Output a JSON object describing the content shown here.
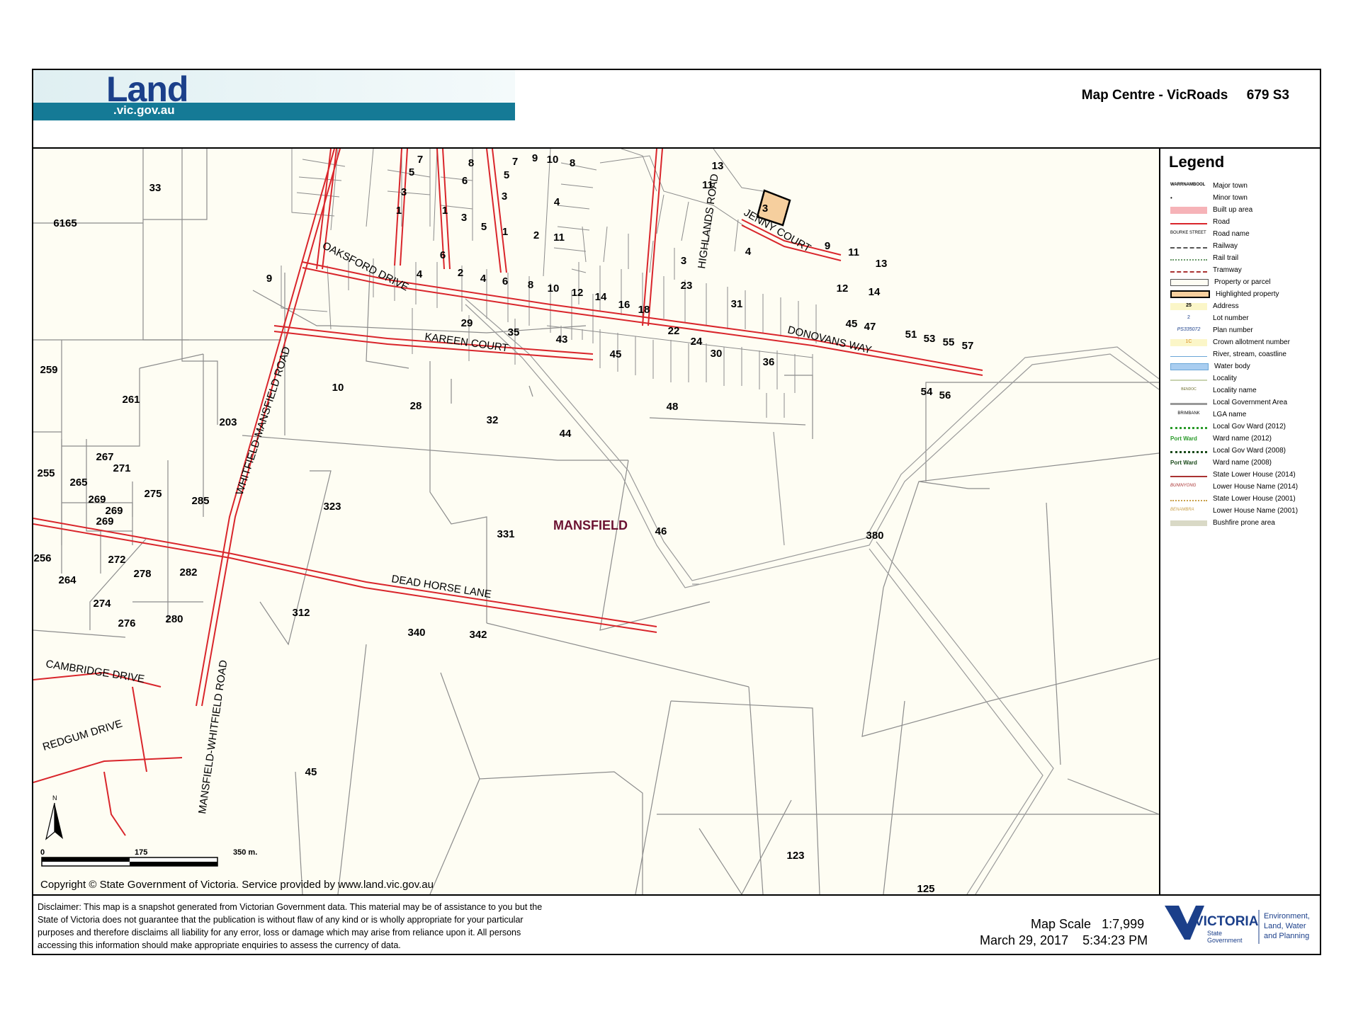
{
  "header": {
    "logo_main": "Land",
    "logo_sub": ".vic.gov.au",
    "title": "Map Centre - VicRoads",
    "map_ref": "679 S3"
  },
  "map": {
    "locality": "MANSFIELD",
    "roads": {
      "whitfield_mansfield": "WHITFIELD-MANSFIELD ROAD",
      "mansfield_whitfield": "MANSFIELD-WHITFIELD ROAD",
      "dead_horse": "DEAD HORSE LANE",
      "oaksford": "OAKSFORD DRIVE",
      "kareen": "KAREEN COURT",
      "highlands": "HIGHLANDS ROAD",
      "jenny": "JENNY COURT",
      "donovans": "DONOVANS WAY",
      "cambridge": "CAMBRIDGE DRIVE",
      "redgum": "REDGUM DRIVE"
    },
    "parcels": [
      "33",
      "6165",
      "9",
      "259",
      "261",
      "203",
      "255",
      "267",
      "271",
      "265",
      "269",
      "269",
      "269",
      "275",
      "285",
      "256",
      "272",
      "278",
      "282",
      "264",
      "274",
      "276",
      "280",
      "10",
      "28",
      "32",
      "44",
      "48",
      "323",
      "331",
      "46",
      "380",
      "312",
      "340",
      "342",
      "45",
      "123",
      "125",
      "7",
      "5",
      "3",
      "1",
      "8",
      "7",
      "9",
      "10",
      "8",
      "6",
      "5",
      "3",
      "1",
      "3",
      "5",
      "1",
      "4",
      "2",
      "11",
      "6",
      "4",
      "2",
      "4",
      "6",
      "8",
      "10",
      "12",
      "14",
      "16",
      "18",
      "22",
      "24",
      "23",
      "29",
      "35",
      "43",
      "45",
      "13",
      "11",
      "3",
      "9",
      "11",
      "13",
      "4",
      "12",
      "14",
      "31",
      "45",
      "47",
      "51",
      "53",
      "55",
      "57",
      "30",
      "36",
      "54",
      "56"
    ],
    "highlighted_parcel": "3",
    "copyright": "Copyright © State Government of Victoria. Service provided by www.land.vic.gov.au",
    "scale_ticks": [
      "0",
      "175",
      "350 m."
    ],
    "north": "N"
  },
  "legend": {
    "title": "Legend",
    "items": [
      {
        "label": "Major town",
        "sample": "WARRNAMBOOL"
      },
      {
        "label": "Minor town",
        "sample": ""
      },
      {
        "label": "Built up area",
        "sample": ""
      },
      {
        "label": "Road",
        "sample": ""
      },
      {
        "label": "Road name",
        "sample": "BOURKE STREET"
      },
      {
        "label": "Railway",
        "sample": ""
      },
      {
        "label": "Rail trail",
        "sample": ""
      },
      {
        "label": "Tramway",
        "sample": ""
      },
      {
        "label": "Property or parcel",
        "sample": ""
      },
      {
        "label": "Highlighted property",
        "sample": ""
      },
      {
        "label": "Address",
        "sample": "25"
      },
      {
        "label": "Lot number",
        "sample": "2"
      },
      {
        "label": "Plan number",
        "sample": "PS335072"
      },
      {
        "label": "Crown allotment number",
        "sample": "1C"
      },
      {
        "label": "River, stream, coastline",
        "sample": ""
      },
      {
        "label": "Water body",
        "sample": ""
      },
      {
        "label": "Locality",
        "sample": ""
      },
      {
        "label": "Locality name",
        "sample": "BENDOC"
      },
      {
        "label": "Local Government Area",
        "sample": ""
      },
      {
        "label": "LGA name",
        "sample": "BRIMBANK"
      },
      {
        "label": "Local Gov Ward (2012)",
        "sample": ""
      },
      {
        "label": "Ward name (2012)",
        "sample": "Port Ward"
      },
      {
        "label": "Local Gov Ward (2008)",
        "sample": ""
      },
      {
        "label": "Ward name (2008)",
        "sample": "Port Ward"
      },
      {
        "label": "State Lower House (2014)",
        "sample": ""
      },
      {
        "label": "Lower House Name (2014)",
        "sample": "BUNINYONG"
      },
      {
        "label": "State Lower House (2001)",
        "sample": ""
      },
      {
        "label": "Lower House Name (2001)",
        "sample": "BENAMBRA"
      },
      {
        "label": "Bushfire prone area",
        "sample": ""
      }
    ]
  },
  "footer": {
    "disclaimer": "Disclaimer: This map is a snapshot generated from Victorian Government data.  This material may be of assistance to you but the State of Victoria does not guarantee that the publication is without flaw of any kind or is wholly appropriate for your particular purposes and therefore disclaims all liability for any error, loss or damage which may arise from reliance upon it. All persons accessing this information should make appropriate enquiries to assess the currency of data.",
    "map_scale_label": "Map Scale",
    "map_scale": "1:7,999",
    "date": "March 29, 2017",
    "time": "5:34:23 PM",
    "vic_logo_main": "VICTORIA",
    "vic_logo_sub1": "State",
    "vic_logo_sub2": "Government",
    "dept1": "Environment,",
    "dept2": "Land, Water",
    "dept3": "and Planning"
  },
  "colors": {
    "road": "#d9252b",
    "parcel_fill": "#fefdf3",
    "parcel_line": "#8c8c8c",
    "highlight_fill": "#f6cf9e",
    "brand_blue": "#157a96",
    "locality": "#6b1232"
  }
}
